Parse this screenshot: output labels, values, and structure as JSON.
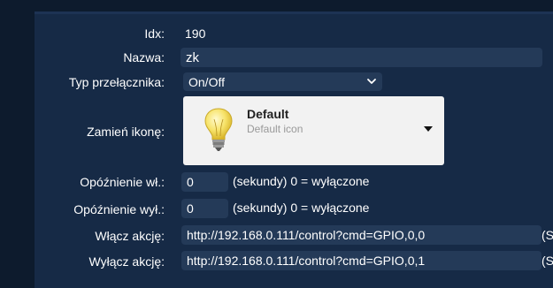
{
  "form": {
    "idx_label": "Idx:",
    "idx_value": "190",
    "name_label": "Nazwa:",
    "name_value": "zk",
    "switch_type_label": "Typ przełącznika:",
    "switch_type_value": "On/Off",
    "icon_label": "Zamień ikonę:",
    "icon_title": "Default",
    "icon_subtitle": "Default icon",
    "on_delay_label": "Opóźnienie wł.:",
    "on_delay_value": "0",
    "on_delay_hint": "(sekundy) 0 = wyłączone",
    "off_delay_label": "Opóźnienie wył.:",
    "off_delay_value": "0",
    "off_delay_hint": "(sekundy) 0 = wyłączone",
    "on_action_label": "Włącz akcję:",
    "on_action_value": "http://192.168.0.111/control?cmd=GPIO,0,0",
    "on_action_suffix": "(S",
    "off_action_label": "Wyłącz akcję:",
    "off_action_value": "http://192.168.0.111/control?cmd=GPIO,0,1",
    "off_action_suffix": "(S"
  },
  "colors": {
    "background": "#0d1b2d",
    "panel": "#162a46",
    "field": "#243a58",
    "picker": "#f2f2f2"
  },
  "icons": [
    "chevron-down-icon",
    "light-bulb-icon",
    "dropdown-arrow-icon"
  ]
}
